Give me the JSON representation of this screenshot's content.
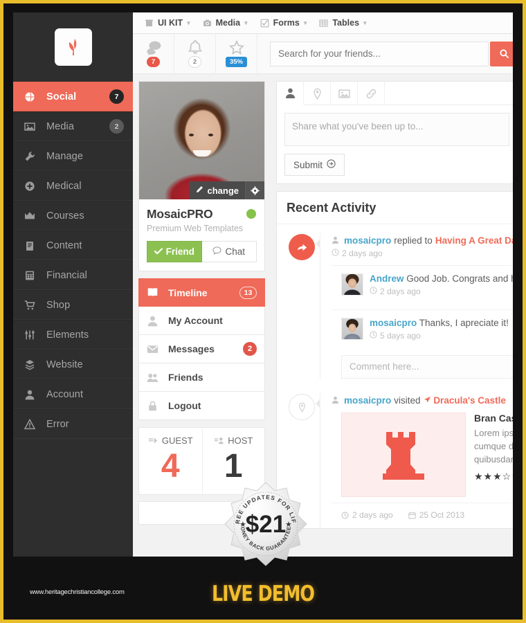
{
  "frame": {
    "border_color": "#e8bd2b",
    "background": "#121111"
  },
  "sidebar": {
    "logo_name": "mosaicpro-leaf-logo",
    "items": [
      {
        "label": "Social",
        "icon": "globe-icon",
        "badge": "7",
        "badge_style": "dark",
        "active": true
      },
      {
        "label": "Media",
        "icon": "image-icon",
        "badge": "2",
        "badge_style": "grey",
        "active": false
      },
      {
        "label": "Manage",
        "icon": "wrench-icon",
        "badge": "",
        "badge_style": "",
        "active": false
      },
      {
        "label": "Medical",
        "icon": "plus-circle-icon",
        "badge": "",
        "badge_style": "",
        "active": false
      },
      {
        "label": "Courses",
        "icon": "crown-icon",
        "badge": "",
        "badge_style": "",
        "active": false
      },
      {
        "label": "Content",
        "icon": "clipboard-icon",
        "badge": "",
        "badge_style": "",
        "active": false
      },
      {
        "label": "Financial",
        "icon": "calculator-icon",
        "badge": "",
        "badge_style": "",
        "active": false
      },
      {
        "label": "Shop",
        "icon": "cart-icon",
        "badge": "",
        "badge_style": "",
        "active": false
      },
      {
        "label": "Elements",
        "icon": "sliders-icon",
        "badge": "",
        "badge_style": "",
        "active": false
      },
      {
        "label": "Website",
        "icon": "sitemap-icon",
        "badge": "",
        "badge_style": "",
        "active": false
      },
      {
        "label": "Account",
        "icon": "user-icon",
        "badge": "",
        "badge_style": "",
        "active": false
      },
      {
        "label": "Error",
        "icon": "warning-icon",
        "badge": "",
        "badge_style": "",
        "active": false
      }
    ]
  },
  "menubar": {
    "items": [
      {
        "label": "UI KIT",
        "icon": "box-icon"
      },
      {
        "label": "Media",
        "icon": "camera-icon"
      },
      {
        "label": "Forms",
        "icon": "checkbox-icon"
      },
      {
        "label": "Tables",
        "icon": "table-icon"
      }
    ],
    "caret": "▾"
  },
  "searchbar": {
    "stats": [
      {
        "icon": "comments-icon",
        "value": "7",
        "style": "red",
        "name": "messages-counter"
      },
      {
        "icon": "bell-icon",
        "value": "2",
        "style": "white",
        "name": "notifications-counter"
      },
      {
        "icon": "star-icon",
        "value": "35%",
        "style": "blue",
        "name": "progress-counter"
      }
    ],
    "placeholder": "Search for your friends...",
    "value": "",
    "search_button_icon": "search-icon",
    "accent": "#ef6a58"
  },
  "profile": {
    "photo_alt": "profile-photo",
    "change_label": "change",
    "change_icon": "pencil-icon",
    "gear_icon": "gear-icon",
    "name": "MosaicPRO",
    "subtitle": "Premium Web Templates",
    "online_color": "#86c24a",
    "friend_label": "Friend",
    "friend_icon": "check-icon",
    "chat_label": "Chat",
    "chat_icon": "comment-icon",
    "menu": [
      {
        "label": "Timeline",
        "icon": "book-icon",
        "badge": "13",
        "badge_style": "outline",
        "active": true
      },
      {
        "label": "My Account",
        "icon": "user-icon",
        "badge": "",
        "badge_style": "",
        "active": false
      },
      {
        "label": "Messages",
        "icon": "envelope-icon",
        "badge": "2",
        "badge_style": "red",
        "active": false
      },
      {
        "label": "Friends",
        "icon": "friends-icon",
        "badge": "",
        "badge_style": "",
        "active": false
      },
      {
        "label": "Logout",
        "icon": "lock-icon",
        "badge": "",
        "badge_style": "",
        "active": false
      }
    ],
    "counters": [
      {
        "label": "GUEST",
        "icon": "guest-icon",
        "value": "4",
        "color": "red"
      },
      {
        "label": "HOST",
        "icon": "host-icon",
        "value": "1",
        "color": "dark"
      }
    ]
  },
  "share": {
    "tabs": [
      {
        "icon": "person-icon",
        "active": true
      },
      {
        "icon": "location-icon",
        "active": false
      },
      {
        "icon": "image-icon",
        "active": false
      },
      {
        "icon": "link-icon",
        "active": false
      }
    ],
    "placeholder": "Share what you've been up to...",
    "value": "",
    "submit_label": "Submit",
    "submit_icon": "arrow-circle-right-icon"
  },
  "activity": {
    "title": "Recent Activity",
    "items": [
      {
        "circle_icon": "share-icon",
        "circle_style": "red",
        "user": "mosaicpro",
        "action": "replied to",
        "target": "Having A Great Day",
        "time": "2 days ago",
        "comments": [
          {
            "author": "Andrew",
            "text": "Good Job. Congrats and hope",
            "time": "2 days ago",
            "avatar": "avatar-andrew"
          },
          {
            "author": "mosaicpro",
            "text": "Thanks, I apreciate it!",
            "time": "5 days ago",
            "avatar": "avatar-mosaicpro"
          }
        ],
        "comment_placeholder": "Comment here..."
      },
      {
        "circle_icon": "location-icon",
        "circle_style": "ghost",
        "user": "mosaicpro",
        "action": "visited",
        "target": "Dracula's Castle",
        "target_icon": "location-arrow-icon",
        "place": {
          "thumb_icon": "castle-rook-icon",
          "title": "Bran Castle",
          "desc_lines": [
            "Lorem ipsum dolor",
            "cumque delectus",
            "quibusdam ipsa"
          ],
          "rating": 3,
          "rating_max": 5,
          "star_filled": "★",
          "star_empty": "☆"
        },
        "meta": [
          {
            "icon": "clock-icon",
            "text": "2 days ago"
          },
          {
            "icon": "calendar-icon",
            "text": "25 Oct 2013"
          }
        ]
      }
    ]
  },
  "sticker": {
    "top_text": "FREE UPDATES FOR LIFE",
    "price": "$21",
    "bottom_text": "MONEY BACK GUARANTEED"
  },
  "footer": {
    "site_url": "www.heritagechristiancollege.com",
    "live_demo": "LIVE DEMO",
    "demo_color": "#f2bd2e"
  }
}
